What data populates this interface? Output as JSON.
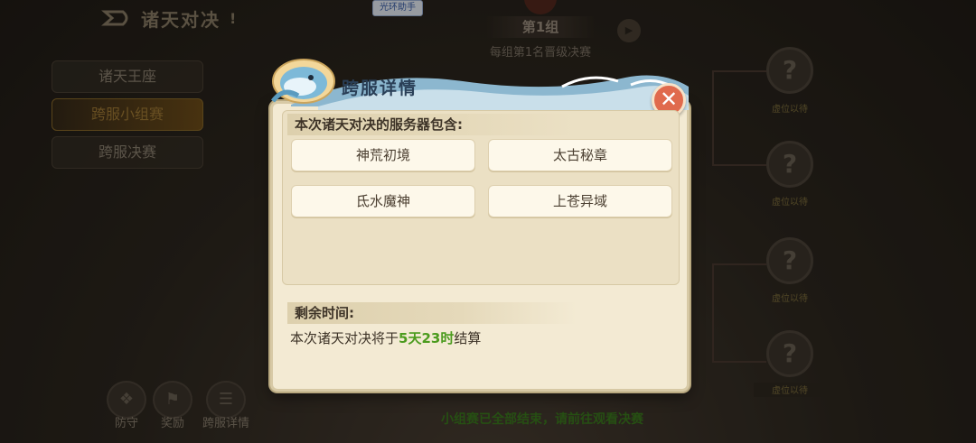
{
  "header": {
    "title": "诸天对决",
    "helper_tag": "光环助手",
    "group_title": "第1组",
    "group_subtitle": "每组第1名晋级决赛"
  },
  "nav": {
    "items": [
      {
        "label": "诸天王座",
        "active": false
      },
      {
        "label": "跨服小组赛",
        "active": true
      },
      {
        "label": "跨服决赛",
        "active": false
      }
    ]
  },
  "bracket": {
    "slots": [
      {
        "icon": "?",
        "label": "虚位以待"
      },
      {
        "icon": "?",
        "label": "虚位以待"
      },
      {
        "icon": "?",
        "label": "虚位以待"
      },
      {
        "icon": "?",
        "label": "虚位以待"
      }
    ]
  },
  "bottom_bar": {
    "items": [
      {
        "label": "防守",
        "icon": "shield-icon"
      },
      {
        "label": "奖励",
        "icon": "gift-icon"
      },
      {
        "label": "跨服详情",
        "icon": "scroll-icon"
      }
    ],
    "message": "小组赛已全部结束，请前往观看决赛"
  },
  "modal": {
    "title": "跨服详情",
    "servers_heading": "本次诸天对决的服务器包含:",
    "servers": [
      "神荒初境",
      "太古秘章",
      "氐水魔神",
      "上苍异域"
    ],
    "remaining_heading": "剩余时间:",
    "countdown_prefix": "本次诸天对决将于",
    "countdown_value": "5天23时",
    "countdown_suffix": "结算"
  },
  "colors": {
    "highlight_green": "#4b9b1e",
    "close_button": "#e06a4d",
    "panel_bg": "#f3ead3"
  }
}
